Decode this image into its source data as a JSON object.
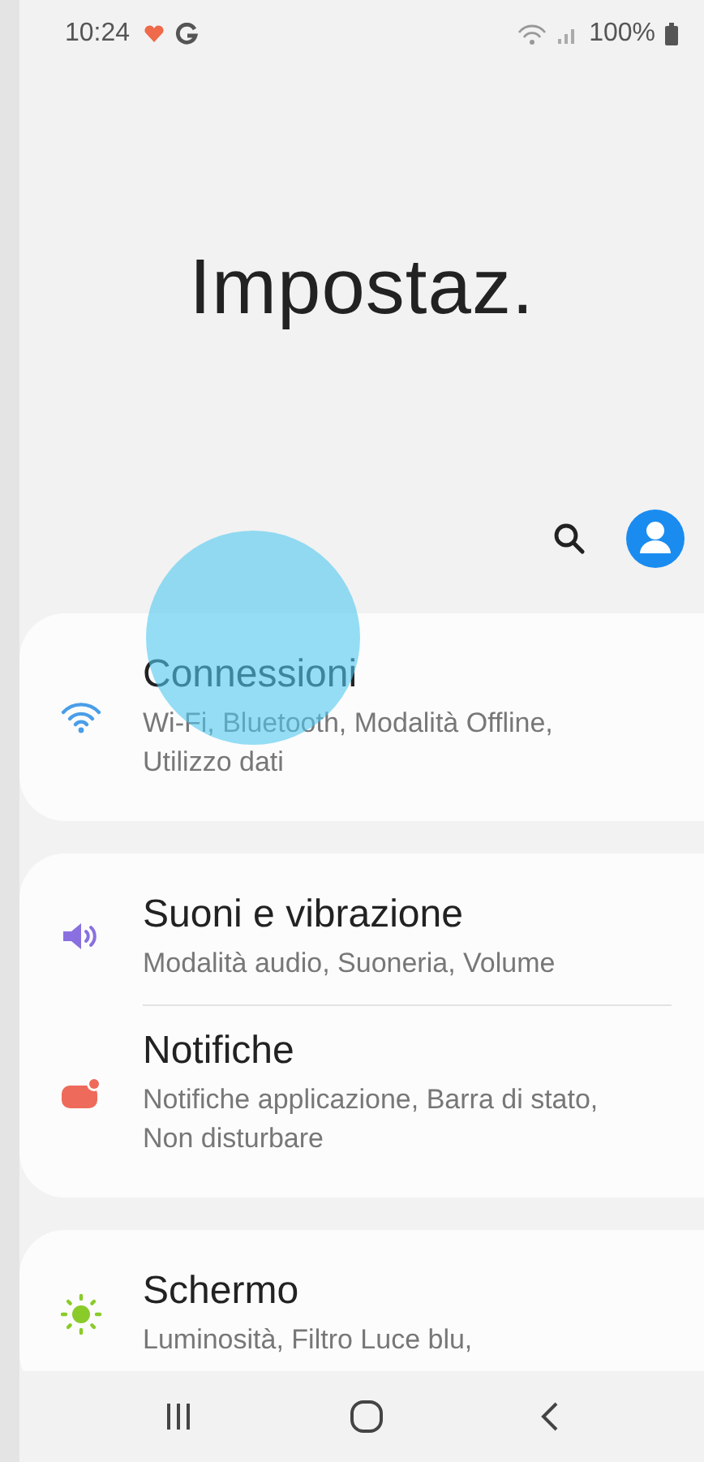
{
  "status_bar": {
    "time": "10:24",
    "battery": "100%"
  },
  "header": {
    "title": "Impostaz."
  },
  "touch_indicator": true,
  "groups": [
    {
      "items": [
        {
          "kind": "wifi",
          "title": "Connessioni",
          "subtitle": "Wi-Fi, Bluetooth, Modalità Offline, Utilizzo dati"
        }
      ]
    },
    {
      "items": [
        {
          "kind": "sound",
          "title": "Suoni e vibrazione",
          "subtitle": "Modalità audio, Suoneria, Volume"
        },
        {
          "kind": "notification",
          "title": "Notifiche",
          "subtitle": "Notifiche applicazione, Barra di stato, Non disturbare"
        }
      ]
    },
    {
      "items": [
        {
          "kind": "display",
          "title": "Schermo",
          "subtitle": "Luminosità, Filtro Luce blu,"
        }
      ]
    }
  ]
}
